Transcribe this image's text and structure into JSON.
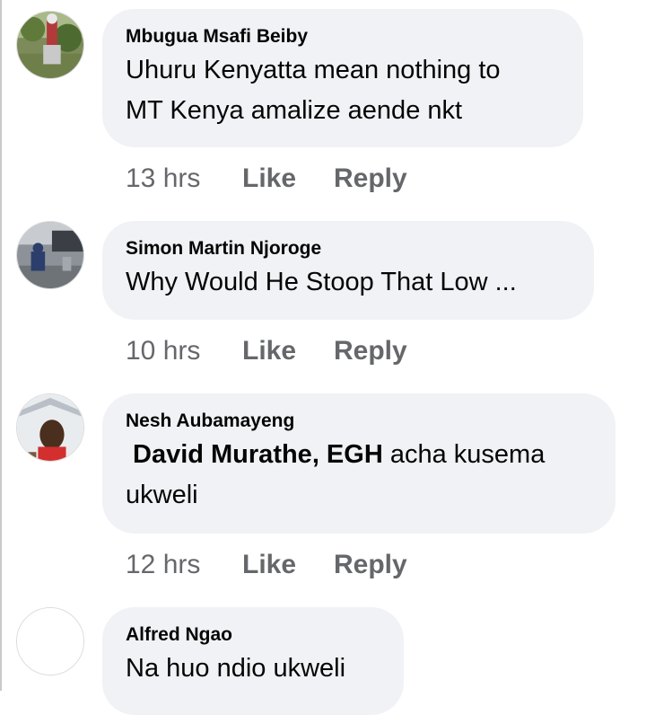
{
  "comments": [
    {
      "author": "Mbugua Msafi Beiby",
      "text_line1": "Uhuru Kenyatta mean nothing to",
      "text_line2": "MT Kenya amalize aende nkt",
      "time": "13 hrs",
      "like": "Like",
      "reply": "Reply"
    },
    {
      "author": "Simon Martin Njoroge",
      "text_line1": "Why Would He Stoop That Low ...",
      "time": "10 hrs",
      "like": "Like",
      "reply": "Reply"
    },
    {
      "author": "Nesh Aubamayeng",
      "mention": "David Murathe, EGH",
      "text_after_mention": " acha kusema",
      "text_line2": "ukweli",
      "time": "12 hrs",
      "like": "Like",
      "reply": "Reply"
    },
    {
      "author": "Alfred Ngao",
      "text_line1": "Na huo ndio ukweli"
    }
  ],
  "colors": {
    "bubble_bg": "#f0f2f5",
    "meta_text": "#65676b",
    "primary_text": "#050505"
  },
  "icons": [
    "avatar-photo-outdoor",
    "avatar-photo-street",
    "avatar-photo-person",
    "avatar-placeholder"
  ]
}
